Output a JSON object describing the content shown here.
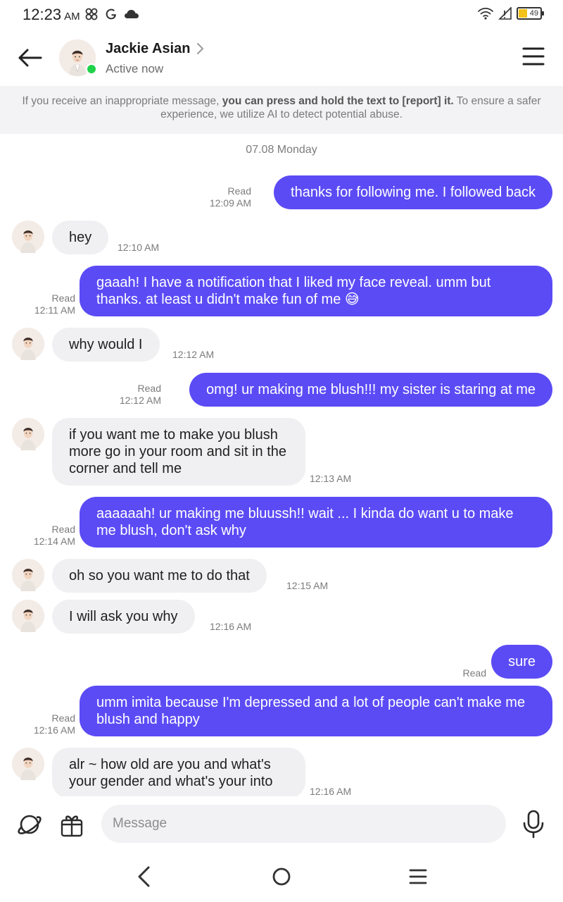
{
  "status_bar": {
    "time": "12:23",
    "ampm": "AM",
    "battery": "49",
    "icons_left": [
      "pinwheel-icon",
      "google-icon",
      "cloud-icon"
    ],
    "icons_right": [
      "wifi-icon",
      "signal-icon",
      "battery-icon"
    ]
  },
  "header": {
    "name": "Jackie Asian",
    "status": "Active now",
    "online": true
  },
  "notice": {
    "part1": "If you receive an inappropriate message, ",
    "bold": "you can press and hold the text to [report] it.",
    "part2": " To ensure a safer experience, we utilize AI to detect potential abuse."
  },
  "date_label": "07.08 Monday",
  "messages": [
    {
      "dir": "out",
      "text": "thanks for following me. I followed back",
      "read": "Read",
      "time": "12:09 AM"
    },
    {
      "dir": "in",
      "text": "hey",
      "time": "12:10 AM"
    },
    {
      "dir": "out",
      "text": "gaaah! I have a notification that I liked my face reveal. umm but thanks. at least u didn't make fun of me 😅",
      "read": "Read",
      "time": "12:11 AM"
    },
    {
      "dir": "in",
      "text": "why would I",
      "time": "12:12 AM"
    },
    {
      "dir": "out",
      "text": "omg! ur making me blush!!! my sister is staring at me",
      "read": "Read",
      "time": "12:12 AM"
    },
    {
      "dir": "in",
      "text": "if you want me to make you blush more go in your room and sit in the corner and tell me",
      "time": "12:13 AM"
    },
    {
      "dir": "out",
      "text": "aaaaaah! ur making me bluussh!! wait ... I kinda do want u to make me blush, don't ask why",
      "read": "Read",
      "time": "12:14 AM"
    },
    {
      "dir": "in",
      "text": "oh so you want me to do that",
      "time": "12:15 AM"
    },
    {
      "dir": "in",
      "text": "I will ask you why",
      "time": "12:16 AM"
    },
    {
      "dir": "out",
      "text": "sure",
      "read": "Read",
      "time": ""
    },
    {
      "dir": "out",
      "text": "umm imita because I'm depressed and a lot of people can't make me blush and happy",
      "read": "Read",
      "time": "12:16 AM"
    },
    {
      "dir": "in",
      "text": "alr ~ how old are you and what's your gender and what's your into",
      "time": "12:16 AM"
    }
  ],
  "composer": {
    "placeholder": "Message"
  },
  "colors": {
    "outgoing_bubble": "#5b4bf5",
    "incoming_bubble": "#f0f0f2",
    "online_dot": "#1fd24a"
  }
}
